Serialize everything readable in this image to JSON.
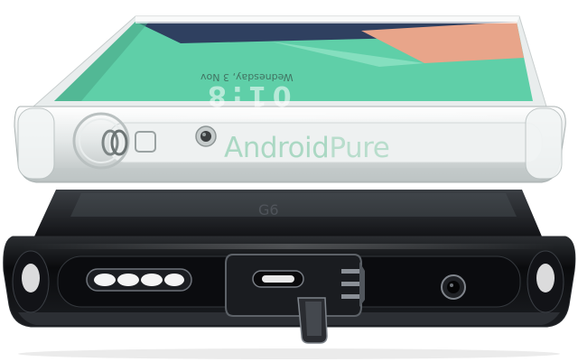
{
  "watermark": {
    "part1": "Android",
    "part2": "Pure"
  },
  "screen": {
    "clock": "01:8",
    "date_line": "Wednesday, 3 Nov"
  },
  "colors": {
    "case_clear": "#e8eceb",
    "screen_green": "#5fcfa8",
    "screen_navy": "#2f4060",
    "screen_salmon": "#e8a58a",
    "phone_black": "#0c0d10",
    "watermark_green": "#3caf78"
  }
}
